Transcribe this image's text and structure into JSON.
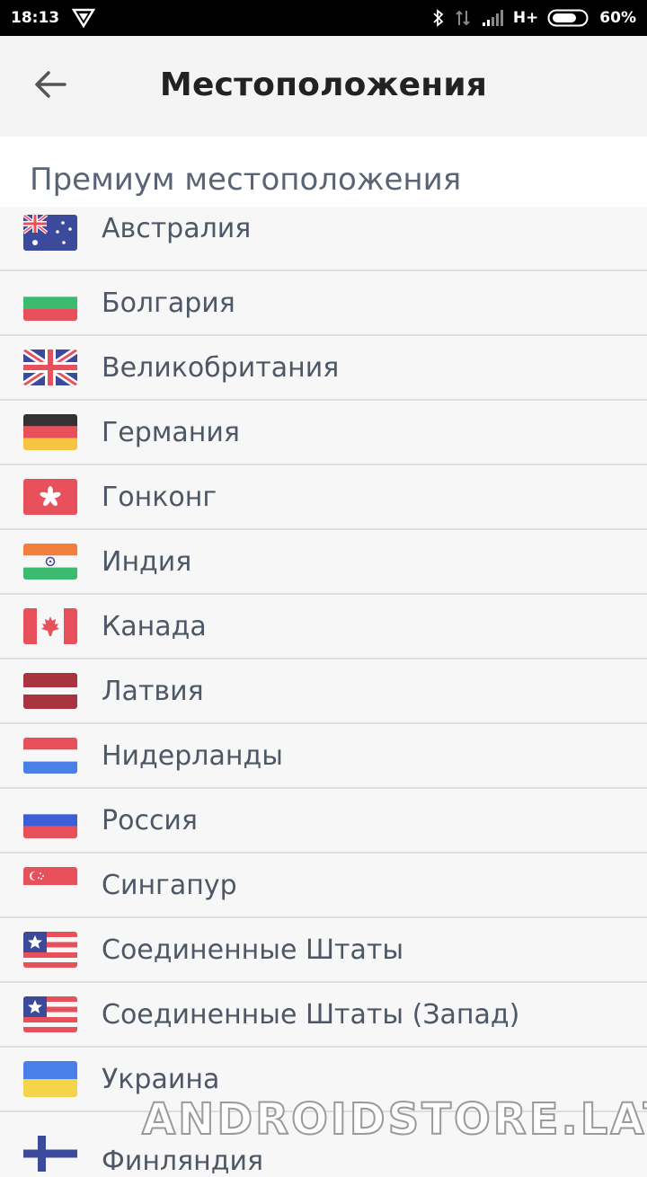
{
  "status_bar": {
    "time": "18:13",
    "network": "H+",
    "battery": "60%"
  },
  "header": {
    "title": "Местоположения"
  },
  "section": {
    "title": "Премиум местоположения"
  },
  "countries": [
    {
      "name": "Австралия",
      "flag": "au-flag-icon"
    },
    {
      "name": "Болгария",
      "flag": "bg-flag-icon"
    },
    {
      "name": "Великобритания",
      "flag": "gb-flag-icon"
    },
    {
      "name": "Германия",
      "flag": "de-flag-icon"
    },
    {
      "name": "Гонконг",
      "flag": "hk-flag-icon"
    },
    {
      "name": "Индия",
      "flag": "in-flag-icon"
    },
    {
      "name": "Канада",
      "flag": "ca-flag-icon"
    },
    {
      "name": "Латвия",
      "flag": "lv-flag-icon"
    },
    {
      "name": "Нидерланды",
      "flag": "nl-flag-icon"
    },
    {
      "name": "Россия",
      "flag": "ru-flag-icon"
    },
    {
      "name": "Сингапур",
      "flag": "sg-flag-icon"
    },
    {
      "name": "Соединенные Штаты",
      "flag": "us-flag-icon"
    },
    {
      "name": "Соединенные Штаты (Запад)",
      "flag": "us-flag-icon"
    },
    {
      "name": "Украина",
      "flag": "ua-flag-icon"
    },
    {
      "name": "Финляндия",
      "flag": "fi-flag-icon"
    }
  ],
  "watermark": "ANDROIDSTORE.LAT"
}
